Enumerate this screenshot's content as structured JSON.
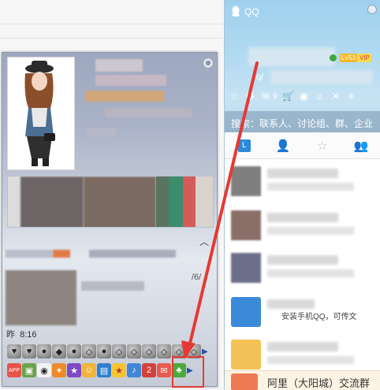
{
  "profile_card": {
    "time_label": "昨",
    "time_value": "8:16",
    "partial_text": "/6/",
    "gift_row_icons": [
      "heart-gray-icon",
      "heart-gray-icon",
      "penguin-gray-icon",
      "gem-gray-icon",
      "penguin-gray-icon",
      "diamond-gray-icon",
      "penguin-gray-icon",
      "diamond-gray-icon",
      "diamond-gray-icon",
      "diamond-gray-icon",
      "diamond-gray-icon",
      "diamond-gray-icon",
      "diamond-gray-icon",
      "gem-gray-icon"
    ],
    "app_row_icons": [
      "app-icon",
      "game-icon",
      "cow-icon",
      "fire-icon",
      "star-icon",
      "face-icon",
      "computer-icon",
      "star-icon",
      "music-icon",
      "number-2-icon",
      "mail-icon",
      "clover-icon"
    ],
    "app_label": "APP",
    "badge_2": "2",
    "colors": {
      "highlight": "#e53935"
    }
  },
  "qq_panel": {
    "title": "QQ",
    "level_badge": "LV53",
    "vip_badge": "VIP",
    "signature_prefix": "q/",
    "mail_count": "9",
    "search_placeholder": "搜索：联系人、讨论组、群、企业",
    "tabs": [
      "recent",
      "contacts",
      "favorites",
      "groups"
    ],
    "recent_tab_label": "L",
    "contact_text": "安装手机QQ，可传文",
    "bottom_item_text": "阿里（大阳城）交流群",
    "colors": {
      "accent": "#2c8ad8"
    }
  }
}
